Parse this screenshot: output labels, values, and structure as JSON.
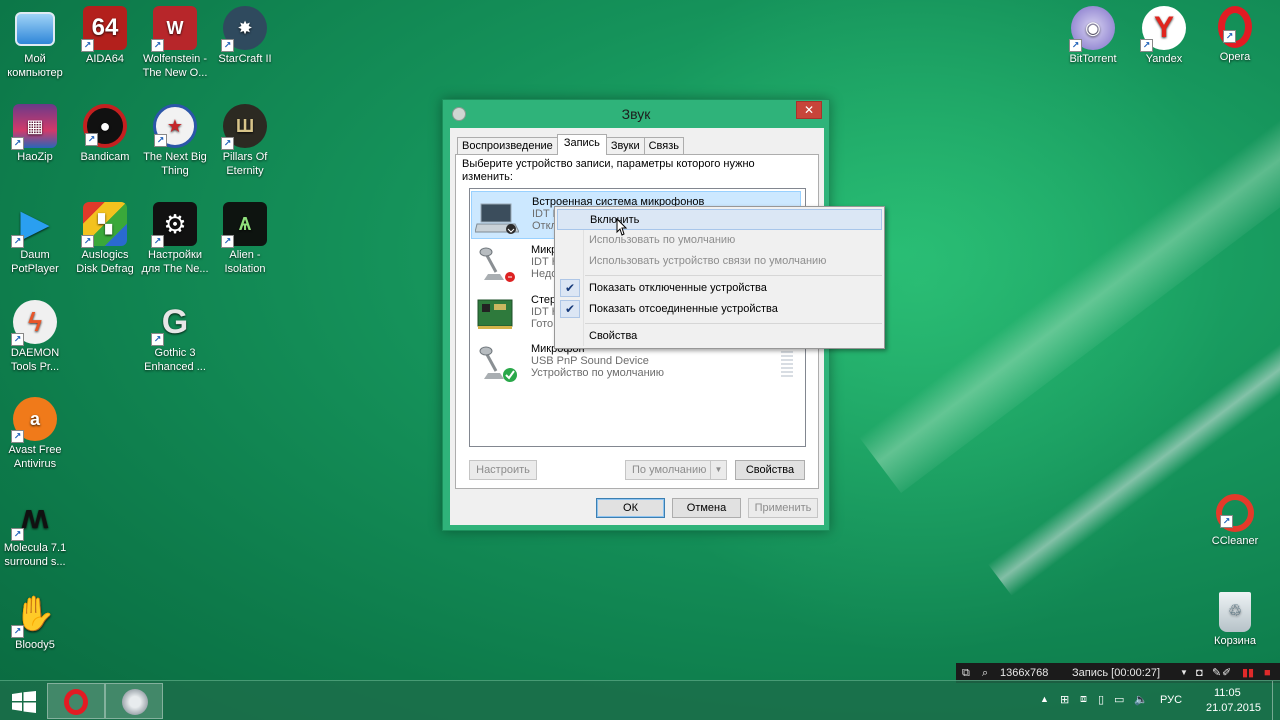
{
  "desktop": {
    "icons_left": [
      {
        "label": "Мой компьютер",
        "icon": "computer-icon"
      },
      {
        "label": "AIDA64",
        "icon": "aida64-icon"
      },
      {
        "label": "Wolfenstein - The New O...",
        "icon": "wolfenstein-icon"
      },
      {
        "label": "StarCraft II",
        "icon": "starcraft-icon"
      },
      {
        "label": "HaoZip",
        "icon": "haozip-icon"
      },
      {
        "label": "Bandicam",
        "icon": "bandicam-icon"
      },
      {
        "label": "The Next Big Thing",
        "icon": "next-big-thing-icon"
      },
      {
        "label": "Pillars Of Eternity",
        "icon": "pillars-icon"
      },
      {
        "label": "Daum PotPlayer",
        "icon": "potplayer-icon"
      },
      {
        "label": "Auslogics Disk Defrag",
        "icon": "defrag-icon"
      },
      {
        "label": "Настройки для The Ne...",
        "icon": "settings-gear-icon"
      },
      {
        "label": "Alien - Isolation",
        "icon": "alien-icon"
      },
      {
        "label": "DAEMON Tools Pr...",
        "icon": "daemon-tools-icon"
      },
      {
        "label": "Gothic 3 Enhanced ...",
        "icon": "gothic-icon"
      },
      {
        "label": "Avast Free Antivirus",
        "icon": "avast-icon"
      },
      {
        "label": "Molecula 7.1 surround s...",
        "icon": "molecula-icon"
      },
      {
        "label": "Bloody5",
        "icon": "bloody-icon"
      }
    ],
    "icons_right": [
      {
        "label": "BitTorrent",
        "icon": "bittorrent-icon"
      },
      {
        "label": "Yandex",
        "icon": "yandex-icon"
      },
      {
        "label": "Opera",
        "icon": "opera-icon"
      },
      {
        "label": "CCleaner",
        "icon": "ccleaner-icon"
      },
      {
        "label": "Корзина",
        "icon": "recycle-bin-icon"
      }
    ]
  },
  "dialog": {
    "title": "Звук",
    "close": "✕",
    "tabs": [
      "Воспроизведение",
      "Запись",
      "Звуки",
      "Связь"
    ],
    "description": "Выберите устройство записи, параметры которого нужно изменить:",
    "devices": [
      {
        "name": "Встроенная система микрофонов",
        "line2": "IDT H",
        "line3": "Откл",
        "state": "disabled"
      },
      {
        "name": "Микр",
        "line2": "IDT H",
        "line3": "Недо",
        "state": "unplugged"
      },
      {
        "name": "Стер",
        "line2": "IDT H",
        "line3": "Гото",
        "state": "ready"
      },
      {
        "name": "Микрофон",
        "line2": "USB PnP Sound Device",
        "line3": "Устройство по умолчанию",
        "state": "default"
      }
    ],
    "buttons": {
      "configure": "Настроить",
      "set_default": "По умолчанию",
      "properties": "Свойства",
      "ok": "ОК",
      "cancel": "Отмена",
      "apply": "Применить"
    }
  },
  "context_menu": {
    "items": [
      {
        "label": "Включить",
        "enabled": true,
        "highlighted": true,
        "checked": false
      },
      {
        "label": "Использовать по умолчанию",
        "enabled": false,
        "checked": false
      },
      {
        "label": "Использовать устройство связи по умолчанию",
        "enabled": false,
        "checked": false
      },
      {
        "label": "Показать отключенные устройства",
        "enabled": true,
        "checked": true
      },
      {
        "label": "Показать отсоединенные устройства",
        "enabled": true,
        "checked": true
      },
      {
        "label": "Свойства",
        "enabled": true,
        "checked": false
      }
    ],
    "check_glyph": "✔"
  },
  "recorder": {
    "resolution": "1366x768",
    "status": "Запись [00:00:27]"
  },
  "taskbar": {
    "language": "РУС",
    "time": "11:05",
    "date": "21.07.2015"
  }
}
